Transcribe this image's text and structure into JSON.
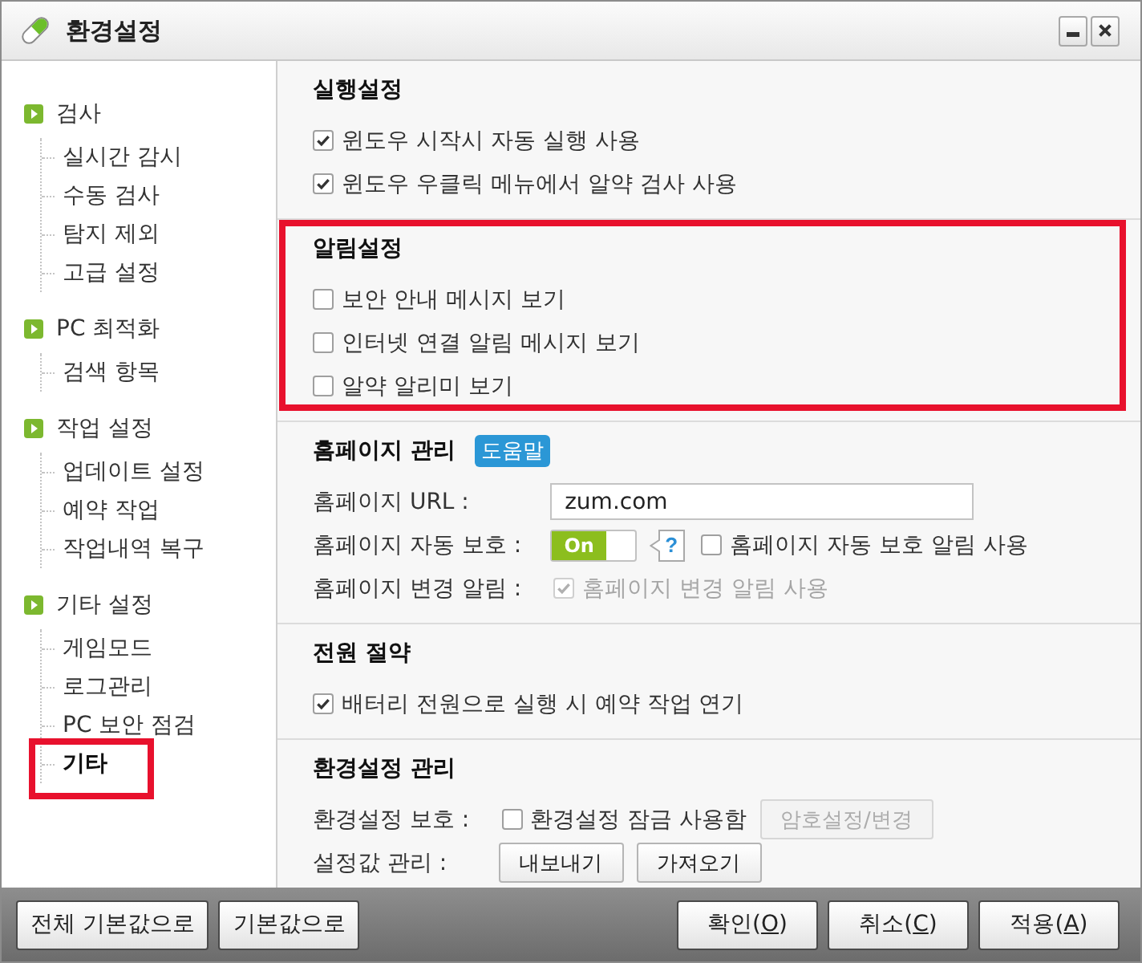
{
  "window": {
    "title": "환경설정"
  },
  "sidebar": {
    "groups": [
      {
        "label": "검사",
        "children": [
          {
            "label": "실시간 감시",
            "selected": false,
            "highlighted": false
          },
          {
            "label": "수동 검사",
            "selected": false,
            "highlighted": false
          },
          {
            "label": "탐지 제외",
            "selected": false,
            "highlighted": false
          },
          {
            "label": "고급 설정",
            "selected": false,
            "highlighted": false
          }
        ]
      },
      {
        "label": "PC 최적화",
        "children": [
          {
            "label": "검색 항목",
            "selected": false,
            "highlighted": false
          }
        ]
      },
      {
        "label": "작업 설정",
        "children": [
          {
            "label": "업데이트 설정",
            "selected": false,
            "highlighted": false
          },
          {
            "label": "예약 작업",
            "selected": false,
            "highlighted": false
          },
          {
            "label": "작업내역 복구",
            "selected": false,
            "highlighted": false
          }
        ]
      },
      {
        "label": "기타 설정",
        "children": [
          {
            "label": "게임모드",
            "selected": false,
            "highlighted": false
          },
          {
            "label": "로그관리",
            "selected": false,
            "highlighted": false
          },
          {
            "label": "PC 보안 점검",
            "selected": false,
            "highlighted": false
          },
          {
            "label": "기타",
            "selected": true,
            "highlighted": true
          }
        ]
      }
    ]
  },
  "sections": [
    {
      "title": "실행설정",
      "highlighted": false,
      "rows": [
        {
          "kind": "checkbox",
          "checkbox": {
            "label": "윈도우 시작시 자동 실행 사용",
            "checked": true,
            "disabled": false
          }
        },
        {
          "kind": "checkbox",
          "checkbox": {
            "label": "윈도우 우클릭 메뉴에서 알약 검사 사용",
            "checked": true,
            "disabled": false
          }
        }
      ]
    },
    {
      "title": "알림설정",
      "highlighted": true,
      "rows": [
        {
          "kind": "checkbox",
          "checkbox": {
            "label": "보안 안내 메시지 보기",
            "checked": false,
            "disabled": false
          }
        },
        {
          "kind": "checkbox",
          "checkbox": {
            "label": "인터넷 연결 알림 메시지 보기",
            "checked": false,
            "disabled": false
          }
        },
        {
          "kind": "checkbox",
          "checkbox": {
            "label": "알약 알리미 보기",
            "checked": false,
            "disabled": false
          }
        }
      ]
    },
    {
      "title": "홈페이지 관리",
      "help": "도움말",
      "highlighted": false,
      "rows": [
        {
          "kind": "form",
          "label": "홈페이지 URL :",
          "controls": [
            {
              "kind": "field",
              "value": "zum.com"
            }
          ]
        },
        {
          "kind": "form",
          "label": "홈페이지 자동 보호 :",
          "controls": [
            {
              "kind": "toggle",
              "text": "On",
              "on": true
            },
            {
              "kind": "help",
              "text": "?"
            },
            {
              "kind": "checkbox",
              "label": "홈페이지 자동 보호 알림 사용",
              "checked": false,
              "disabled": false
            }
          ]
        },
        {
          "kind": "form",
          "label": "홈페이지 변경 알림 :",
          "controls": [
            {
              "kind": "checkbox",
              "label": "홈페이지 변경 알림 사용",
              "checked": true,
              "disabled": true
            }
          ]
        }
      ]
    },
    {
      "title": "전원 절약",
      "highlighted": false,
      "rows": [
        {
          "kind": "checkbox",
          "checkbox": {
            "label": "배터리 전원으로 실행 시 예약 작업 연기",
            "checked": true,
            "disabled": false
          }
        }
      ]
    },
    {
      "title": "환경설정 관리",
      "highlighted": false,
      "rows": [
        {
          "kind": "form",
          "label": "환경설정 보호 :",
          "controls": [
            {
              "kind": "checkbox",
              "label": "환경설정 잠금 사용함",
              "checked": false,
              "disabled": false
            },
            {
              "kind": "button",
              "text": "암호설정/변경",
              "disabled": true
            }
          ]
        },
        {
          "kind": "form",
          "label": "설정값 관리 :",
          "controls": [
            {
              "kind": "button",
              "text": "내보내기",
              "disabled": false
            },
            {
              "kind": "button",
              "text": "가져오기",
              "disabled": false
            }
          ]
        }
      ]
    }
  ],
  "footer": {
    "left_buttons": [
      {
        "text": "전체 기본값으로"
      },
      {
        "text": "기본값으로"
      }
    ],
    "right_buttons": [
      {
        "text": "확인(",
        "key": "O",
        "after": ")"
      },
      {
        "text": "취소(",
        "key": "C",
        "after": ")"
      },
      {
        "text": "적용(",
        "key": "A",
        "after": ")"
      }
    ]
  }
}
